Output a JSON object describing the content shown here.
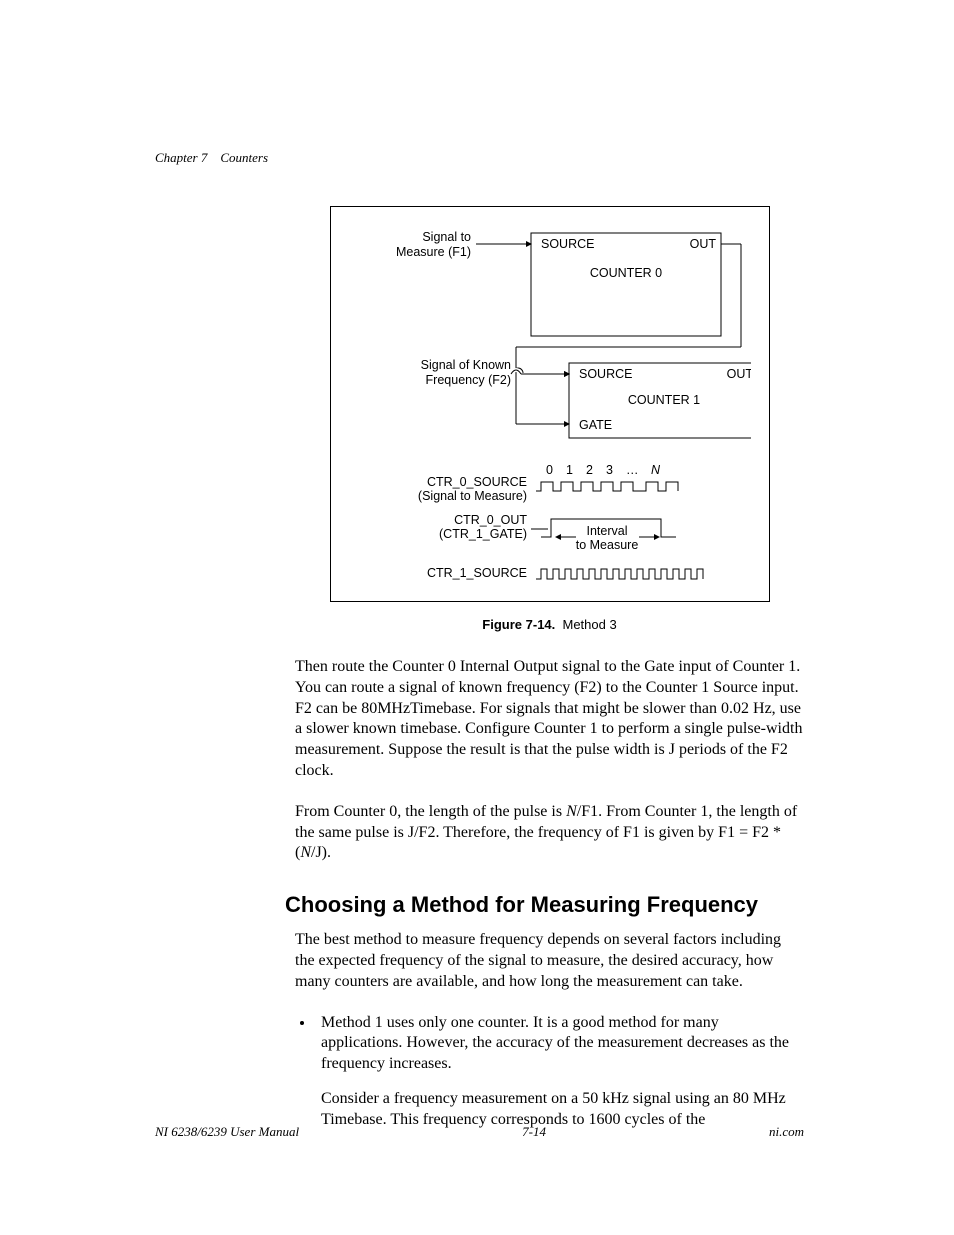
{
  "header": {
    "chapter": "Chapter 7",
    "title": "Counters"
  },
  "figure": {
    "signal_to_measure": "Signal to\nMeasure (F1)",
    "source0": "SOURCE",
    "out0": "OUT",
    "counter0": "COUNTER 0",
    "signal_known": "Signal of Known\nFrequency (F2)",
    "source1": "SOURCE",
    "out1": "OUT",
    "counter1": "COUNTER 1",
    "gate": "GATE",
    "ticks": "0   1   2   3   …   N",
    "tick_n": "N",
    "ctr0_src": "CTR_0_SOURCE",
    "ctr0_src_sub": "(Signal to Measure)",
    "ctr0_out": "CTR_0_OUT",
    "ctr0_out_sub": "(CTR_1_GATE)",
    "interval": "Interval",
    "interval_sub": "to Measure",
    "ctr1_src": "CTR_1_SOURCE",
    "caption_bold": "Figure 7-14.",
    "caption_rest": "Method 3"
  },
  "paragraphs": {
    "p1": "Then route the Counter 0 Internal Output signal to the Gate input of Counter 1. You can route a signal of known frequency (F2) to the Counter 1 Source input. F2 can be 80MHzTimebase. For signals that might be slower than 0.02 Hz, use a slower known timebase. Configure Counter 1 to perform a single pulse-width measurement. Suppose the result is that the pulse width is J periods of the F2 clock.",
    "p2a": "From Counter 0, the length of the pulse is ",
    "p2b": "/F1. From Counter 1, the length of the same pulse is J/F2. Therefore, the frequency of F1 is given by F1 = F2 * (",
    "p2c": "/J).",
    "n": "N"
  },
  "heading": "Choosing a Method for Measuring Frequency",
  "paragraphs2": {
    "p3": "The best method to measure frequency depends on several factors including the expected frequency of the signal to measure, the desired accuracy, how many counters are available, and how long the measurement can take."
  },
  "bullets": {
    "b1": "Method 1 uses only one counter. It is a good method for many applications. However, the accuracy of the measurement decreases as the frequency increases.",
    "b1b": "Consider a frequency measurement on a 50 kHz signal using an 80 MHz Timebase. This frequency corresponds to 1600 cycles of the"
  },
  "footer": {
    "left": "NI 6238/6239 User Manual",
    "center": "7-14",
    "right": "ni.com"
  }
}
